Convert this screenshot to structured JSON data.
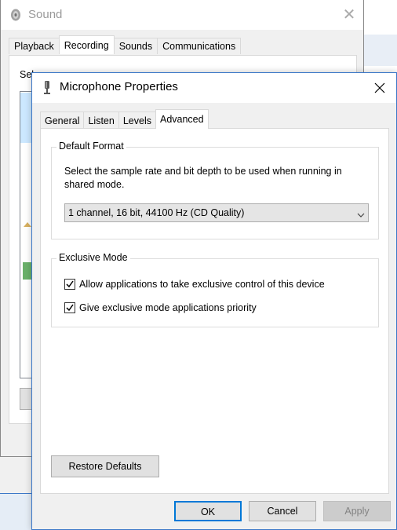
{
  "sound_window": {
    "title": "Sound",
    "tabs": [
      {
        "label": "Playback"
      },
      {
        "label": "Recording",
        "active": true
      },
      {
        "label": "Sounds"
      },
      {
        "label": "Communications"
      }
    ],
    "select_text_partial": "Sel"
  },
  "mic_window": {
    "title": "Microphone Properties",
    "tabs": [
      {
        "label": "General"
      },
      {
        "label": "Listen"
      },
      {
        "label": "Levels"
      },
      {
        "label": "Advanced",
        "active": true
      }
    ],
    "default_format": {
      "legend": "Default Format",
      "description": "Select the sample rate and bit depth to be used when running in shared mode.",
      "selected_format": "1 channel, 16 bit, 44100 Hz (CD Quality)"
    },
    "exclusive_mode": {
      "legend": "Exclusive Mode",
      "allow_exclusive_label": "Allow applications to take exclusive control of this device",
      "allow_exclusive_checked": true,
      "priority_label": "Give exclusive mode applications priority",
      "priority_checked": true
    },
    "restore_defaults_label": "Restore Defaults",
    "ok_label": "OK",
    "cancel_label": "Cancel",
    "apply_label": "Apply"
  },
  "colors": {
    "accent": "#0078d7",
    "window_border": "#3c78c8",
    "dialog_bg": "#f0f0f0"
  },
  "icons": [
    "speaker-icon",
    "close-icon",
    "microphone-icon",
    "chevron-down-icon",
    "checkmark-icon"
  ]
}
